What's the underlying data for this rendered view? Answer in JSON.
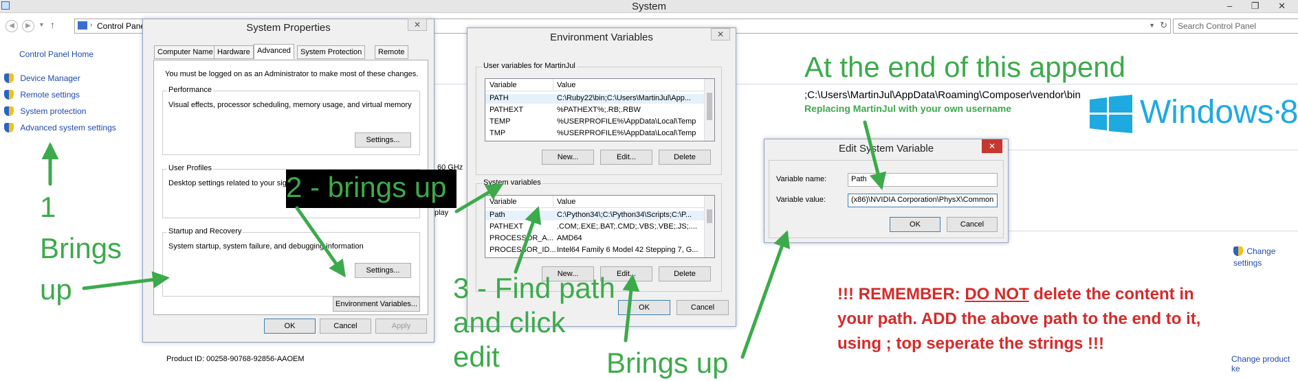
{
  "window": {
    "title": "System",
    "controls": [
      "–",
      "❐",
      "✕"
    ]
  },
  "address": {
    "path": "Control Panel",
    "search_placeholder": "Search Control Panel"
  },
  "sidebar": {
    "home": "Control Panel Home",
    "items": [
      "Device Manager",
      "Remote settings",
      "System protection",
      "Advanced system settings"
    ]
  },
  "background": {
    "cpu_fragment": "60 GHz",
    "display_fragment": "play",
    "product_id": "Product ID:  00258-90768-92856-AAOEM",
    "change_settings": "Change settings",
    "change_product_key": "Change product ke"
  },
  "system_properties": {
    "title": "System Properties",
    "tabs": [
      "Computer Name",
      "Hardware",
      "Advanced",
      "System Protection",
      "Remote"
    ],
    "admin_note": "You must be logged on as an Administrator to make most of these changes.",
    "performance": {
      "label": "Performance",
      "desc": "Visual effects, processor scheduling, memory usage, and virtual memory",
      "button": "Settings..."
    },
    "profiles": {
      "label": "User Profiles",
      "desc": "Desktop settings related to your sign-in"
    },
    "startup": {
      "label": "Startup and Recovery",
      "desc": "System startup, system failure, and debugging information",
      "button": "Settings..."
    },
    "env_button": "Environment Variables...",
    "ok": "OK",
    "cancel": "Cancel",
    "apply": "Apply"
  },
  "env_vars": {
    "title": "Environment Variables",
    "user_group": "User variables for MartinJul",
    "system_group": "System variables",
    "col_variable": "Variable",
    "col_value": "Value",
    "user_rows": [
      {
        "variable": "PATH",
        "value": "C:\\Ruby22\\bin;C:\\Users\\MartinJul\\App..."
      },
      {
        "variable": "PATHEXT",
        "value": "%PATHEXT%;.RB;.RBW"
      },
      {
        "variable": "TEMP",
        "value": "%USERPROFILE%\\AppData\\Local\\Temp"
      },
      {
        "variable": "TMP",
        "value": "%USERPROFILE%\\AppData\\Local\\Temp"
      }
    ],
    "system_rows": [
      {
        "variable": "Path",
        "value": "C:\\Python34\\;C:\\Python34\\Scripts;C:\\P..."
      },
      {
        "variable": "PATHEXT",
        "value": ".COM;.EXE;.BAT;.CMD;.VBS;.VBE;.JS;...."
      },
      {
        "variable": "PROCESSOR_A...",
        "value": "AMD64"
      },
      {
        "variable": "PROCESSOR_ID...",
        "value": "Intel64 Family 6 Model 42 Stepping 7, G..."
      }
    ],
    "new": "New...",
    "edit": "Edit...",
    "delete": "Delete",
    "ok": "OK",
    "cancel": "Cancel"
  },
  "edit_var": {
    "title": "Edit System Variable",
    "name_label": "Variable name:",
    "name_value": "Path",
    "value_label": "Variable value:",
    "value_value": "(x86)\\NVIDIA Corporation\\PhysX\\Common",
    "ok": "OK",
    "cancel": "Cancel"
  },
  "annotations": {
    "step1_num": "1",
    "step1_a": "Brings",
    "step1_b": "up",
    "step2": "2 - brings up",
    "step3_a": "3 - Find path",
    "step3_b": "and click",
    "step3_c": "edit",
    "brings_up": "Brings up",
    "append_title": "At the end of this append",
    "append_path": ";C:\\Users\\MartinJul\\AppData\\Roaming\\Composer\\vendor\\bin",
    "replace_note": "Replacing MartinJul with your own username",
    "remember_lead": "!!! REMEMBER: ",
    "remember_donot": "DO NOT",
    "remember_rest1": " delete the content in",
    "remember_line2": "your path. ADD the above path to the end to it,",
    "remember_line3": "using ; top seperate the strings !!!",
    "logo_text": "Windows",
    "logo_num": "8"
  },
  "colors": {
    "annotation_green": "#3caa4b",
    "warning_red": "#d62a2a",
    "logo_blue": "#1fa9e1"
  }
}
